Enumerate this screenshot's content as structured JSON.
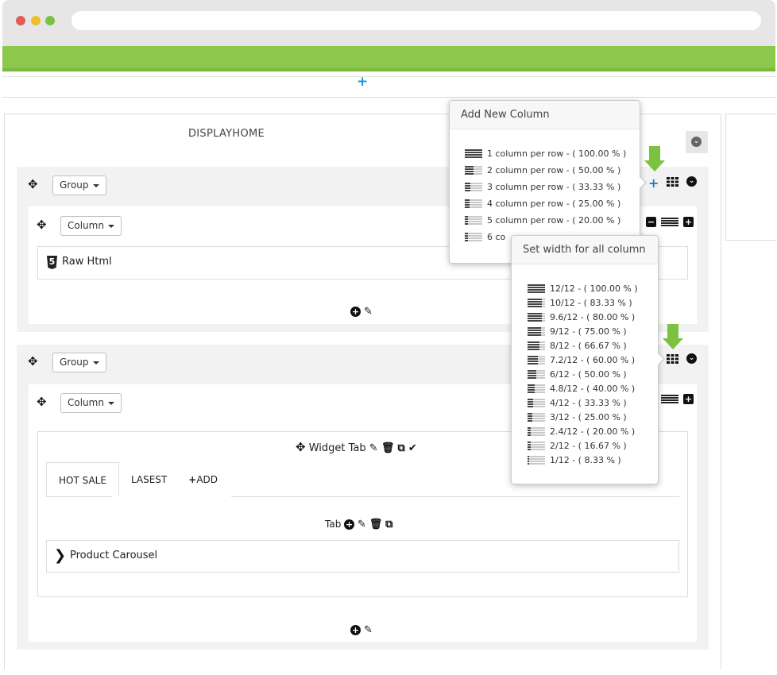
{
  "browser": {
    "dots": [
      "#e15b5b",
      "#f1bd2a",
      "#7bc142"
    ],
    "accent": "#8cc84b"
  },
  "hook": {
    "title": "DISPLAYHOME"
  },
  "group1": {
    "group_label": "Group",
    "column_label": "Column",
    "widget_label": "Raw Html"
  },
  "group2": {
    "group_label": "Group",
    "column_label": "Column",
    "widget_tab_label": "Widget Tab",
    "tabs": [
      "HOT SALE",
      "LASEST"
    ],
    "add_label": "ADD",
    "tab_label": "Tab",
    "product_label": "Product Carousel"
  },
  "add_column_popup": {
    "title": "Add New Column",
    "options": [
      {
        "label": "1 column per row - ( 100.00 % )",
        "fraction": 1.0
      },
      {
        "label": "2 column per row - ( 50.00 % )",
        "fraction": 0.5
      },
      {
        "label": "3 column per row - ( 33.33 % )",
        "fraction": 0.3333
      },
      {
        "label": "4 column per row - ( 25.00 % )",
        "fraction": 0.25
      },
      {
        "label": "5 column per row - ( 20.00 % )",
        "fraction": 0.2
      },
      {
        "label": "6 co",
        "fraction": 0.1667
      }
    ]
  },
  "width_popup": {
    "title": "Set width for all column",
    "options": [
      {
        "label": "12/12 - ( 100.00 % )",
        "fraction": 1.0
      },
      {
        "label": "10/12 - ( 83.33 % )",
        "fraction": 0.8333
      },
      {
        "label": "9.6/12 - ( 80.00 % )",
        "fraction": 0.8
      },
      {
        "label": "9/12 - ( 75.00 % )",
        "fraction": 0.75
      },
      {
        "label": "8/12 - ( 66.67 % )",
        "fraction": 0.6667
      },
      {
        "label": "7.2/12 - ( 60.00 % )",
        "fraction": 0.6
      },
      {
        "label": "6/12 - ( 50.00 % )",
        "fraction": 0.5
      },
      {
        "label": "4.8/12 - ( 40.00 % )",
        "fraction": 0.4
      },
      {
        "label": "4/12 - ( 33.33 % )",
        "fraction": 0.3333
      },
      {
        "label": "3/12 - ( 25.00 % )",
        "fraction": 0.25
      },
      {
        "label": "2.4/12 - ( 20.00 % )",
        "fraction": 0.2
      },
      {
        "label": "2/12 - ( 16.67 % )",
        "fraction": 0.1667
      },
      {
        "label": "1/12 - ( 8.33 % )",
        "fraction": 0.0833
      }
    ]
  }
}
